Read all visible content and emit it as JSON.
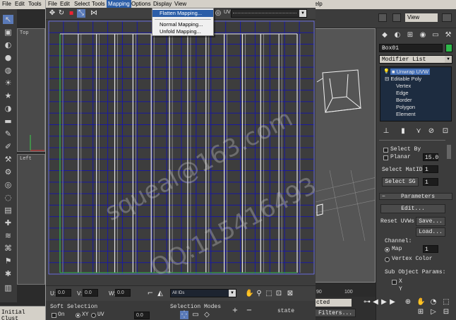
{
  "app": {
    "menubar": {
      "file": "File",
      "edit": "Edit",
      "tools": "Tools",
      "help_fragment": "elp"
    },
    "viewports": {
      "top": "Top",
      "left": "Left",
      "perspective_view_menu": "View"
    },
    "status_left": "Initial Clust"
  },
  "uvw_editor": {
    "menu": [
      "File",
      "Edit",
      "Select",
      "Tools",
      "Mapping",
      "Options",
      "Display",
      "View"
    ],
    "active_menu": "Mapping",
    "mapping_menu": {
      "items": [
        {
          "label": "Flatten Mapping...",
          "highlighted": true
        },
        {
          "label": "Normal Mapping...",
          "highlighted": false
        },
        {
          "label": "Unfold Mapping...",
          "highlighted": false
        }
      ]
    },
    "toolbar": {
      "uv_label": "UV",
      "icons": [
        "move-icon",
        "rotate-icon",
        "scale-icon",
        "freeform-icon",
        "mirror-icon",
        "show-map-icon"
      ]
    },
    "bottom_bar": {
      "u_label": "U:",
      "u_value": "0.0",
      "v_label": "V:",
      "v_value": "0.0",
      "w_label": "W:",
      "w_value": "0.0",
      "texture_label": "All IDs"
    },
    "options_bar": {
      "soft_selection_label": "Soft Selection",
      "on_label": "On",
      "xy_label": "XY",
      "uv_label": "UV",
      "falloff_value": "0.0",
      "selection_modes_label": "Selection Modes",
      "state_label": "state",
      "filters_label": "Filters..."
    },
    "grid": {
      "columns": 13,
      "rows": 16,
      "line_color": "#1a1aa0",
      "edge_color": "#e8e8e8",
      "seam_color": "#2fb84a"
    }
  },
  "command_panel": {
    "object_name": "Box01",
    "object_color": "#2fb84a",
    "modifier_list_label": "Modifier List",
    "stack": {
      "unwrap": "Unwrap UVW",
      "editable_poly": "Editable Poly",
      "sub_objects": [
        "Vertex",
        "Edge",
        "Border",
        "Polygon",
        "Element"
      ]
    },
    "select_by_label": "Select By",
    "planar_label": "Planar",
    "planar_value": "15.0",
    "select_matid_label": "Select MatID",
    "select_matid_value": "1",
    "select_sg_label": "Select SG",
    "select_sg_value": "1",
    "parameters_label": "Parameters",
    "edit_button": "Edit...",
    "reset_uvws_button": "Reset UVWs",
    "save_button": "Save...",
    "load_button": "Load...",
    "channel_label": "Channel:",
    "map_label": "Map",
    "map_value": "1",
    "vertex_color_label": "Vertex Color",
    "sub_object_params_label": "Sub Object Params:",
    "x_label": "X",
    "y_label": "Y"
  },
  "right_area": {
    "selected_fragment": "cted",
    "filters_label": "Filters...",
    "frame_90": "90",
    "frame_100": "100"
  },
  "watermark": {
    "line1": "squeal@163.com",
    "line2": "QQ:115416493"
  }
}
